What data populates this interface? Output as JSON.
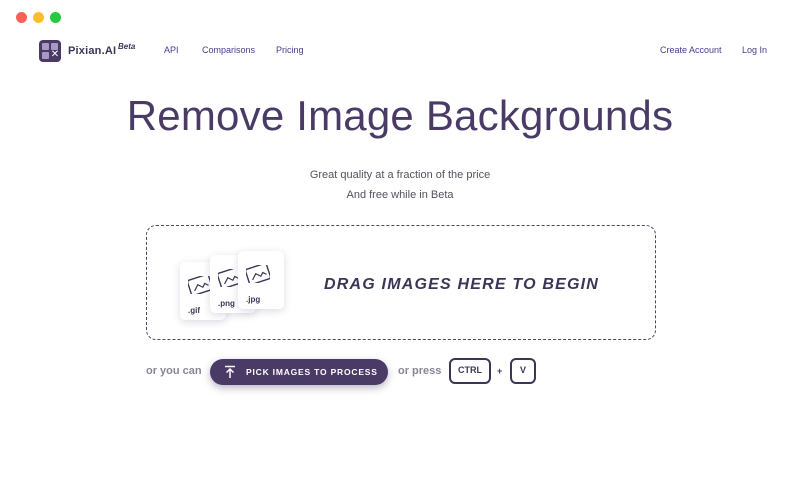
{
  "window": {
    "controls": [
      "close",
      "minimize",
      "maximize"
    ]
  },
  "nav": {
    "brand": "Pixian.AI",
    "badge": "Beta",
    "links": [
      "API",
      "Comparisons",
      "Pricing"
    ],
    "right_links": [
      "Create Account",
      "Log In"
    ]
  },
  "hero": {
    "title": "Remove Image Backgrounds",
    "subtitle_1": "Great quality at a fraction of the price",
    "subtitle_2": "And free while in Beta"
  },
  "dropzone": {
    "file_types": [
      ".gif",
      ".png",
      ".jpg"
    ],
    "prompt": "DRAG IMAGES HERE TO BEGIN"
  },
  "actions": {
    "or_you_can": "or you can",
    "pick_label": "PICK IMAGES TO PROCESS",
    "or_press": "or press",
    "key_1": "CTRL",
    "plus": "+",
    "key_2": "V"
  },
  "colors": {
    "accent": "#4a3b66",
    "link": "#4a3b8a"
  },
  "icons": {
    "logo": "pixian-logo-icon",
    "upload": "upload-arrow-icon",
    "image": "image-file-icon"
  }
}
